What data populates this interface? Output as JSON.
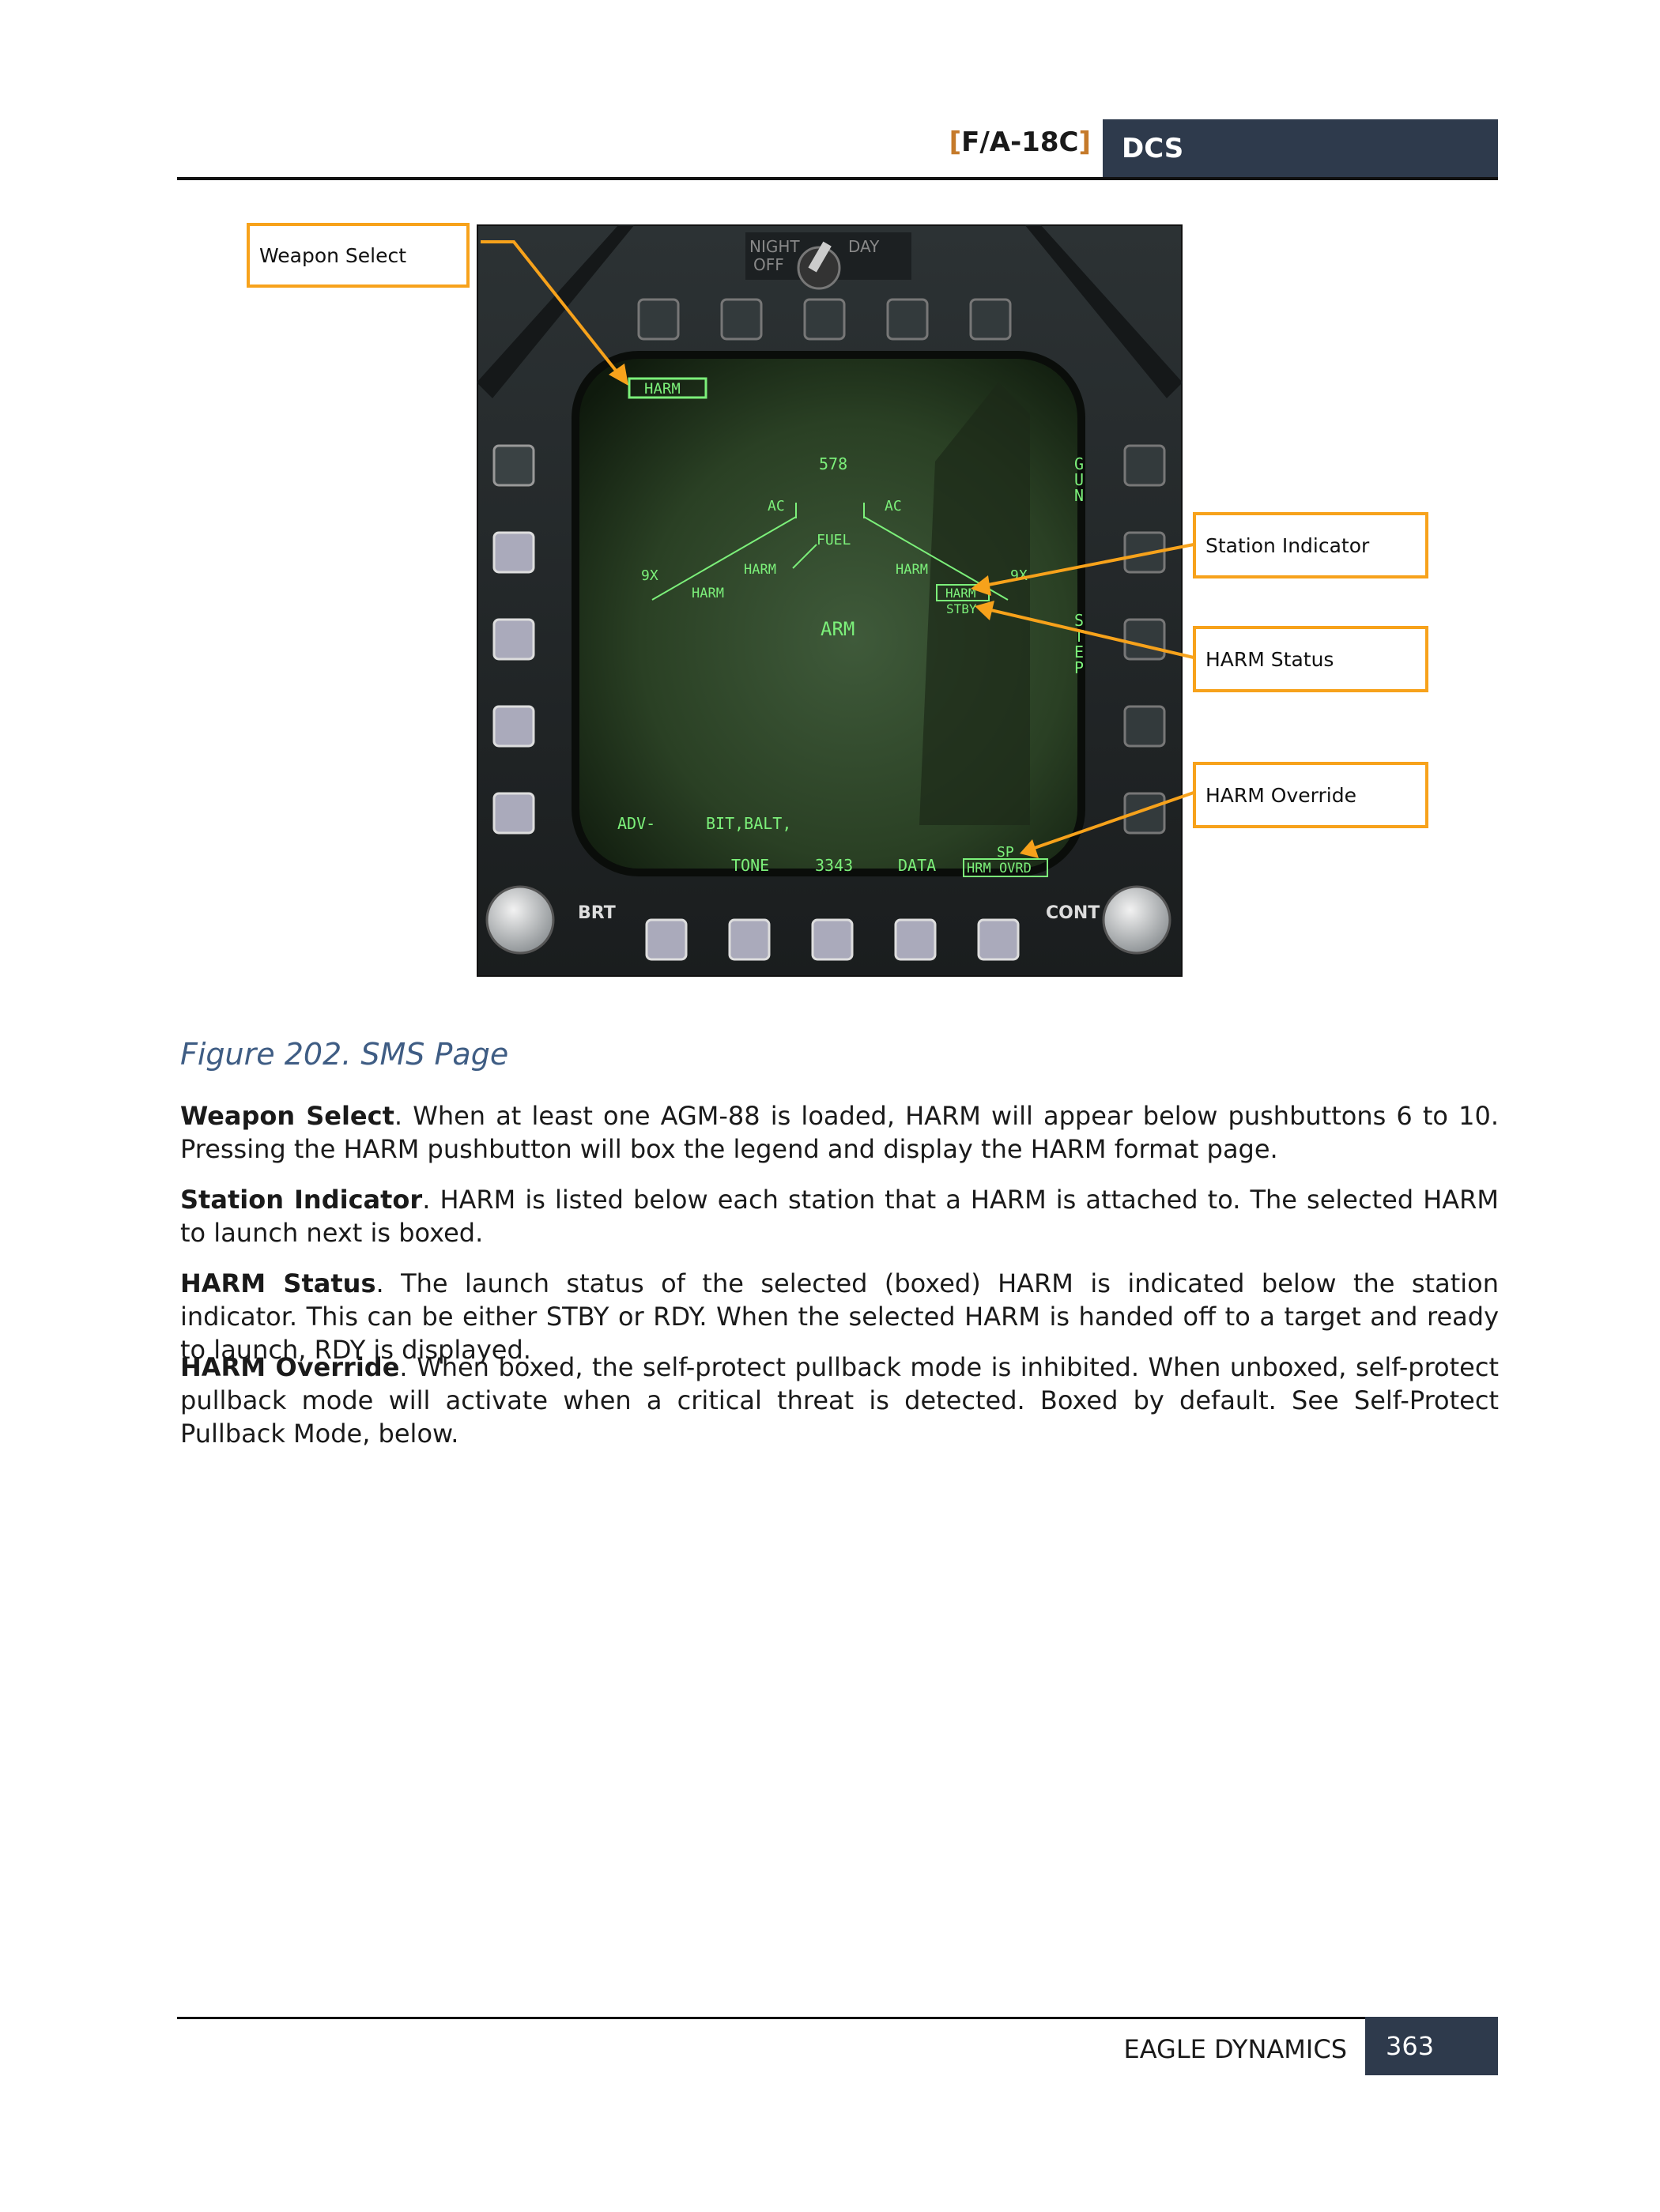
{
  "header": {
    "product": "F/A-18C",
    "brand": "DCS"
  },
  "figure": {
    "caption": "Figure 202. SMS Page",
    "callouts": {
      "weapon_select": "Weapon Select",
      "station_indicator": "Station Indicator",
      "harm_status": "HARM Status",
      "harm_override": "HARM Override"
    },
    "panel": {
      "night_label": "NIGHT",
      "off_label": "OFF",
      "day_label": "DAY",
      "brt_label": "BRT",
      "cont_label": "CONT"
    },
    "display": {
      "weapon_select_box": "HARM",
      "top_number": "578",
      "left_ac": "AC",
      "right_ac": "AC",
      "fuel": "FUEL",
      "left_9x": "9X",
      "right_9x": "9X",
      "left_harm_outer": "HARM",
      "left_harm_inner": "HARM",
      "right_harm_inner": "HARM",
      "right_harm_boxed": "HARM",
      "status": "STBY",
      "arm": "ARM",
      "gun": "GUN",
      "step": "STEP",
      "adv": "ADV-",
      "bit_balt": "BIT,BALT,",
      "tone": "TONE",
      "code": "3343",
      "data": "DATA",
      "sp": "SP",
      "harm_ovrd": "HRM OVRD"
    },
    "colors": {
      "callout_border": "#f7a21b",
      "mfd_green": "#7cf07a",
      "header_bg": "#2e3a4c"
    }
  },
  "sections": [
    {
      "title": "Weapon Select",
      "text": ". When at least one AGM-88 is loaded, HARM will appear below pushbuttons 6 to 10. Pressing the HARM pushbutton will box the legend and display the HARM format page."
    },
    {
      "title": "Station Indicator",
      "text": ". HARM is listed below each station that a HARM is attached to. The selected HARM to launch next is boxed."
    },
    {
      "title": "HARM Status",
      "text": ". The launch status of the selected (boxed) HARM is indicated below the station indicator. This can be either STBY or RDY. When the selected HARM is handed off to a target and ready to launch, RDY is displayed."
    },
    {
      "title": "HARM Override",
      "text": ". When boxed, the self-protect pullback mode is inhibited. When unboxed, self-protect pullback mode will activate when a critical threat is detected. Boxed by default. See Self-Protect Pullback Mode, below."
    }
  ],
  "footer": {
    "company": "EAGLE DYNAMICS",
    "page": "363"
  }
}
